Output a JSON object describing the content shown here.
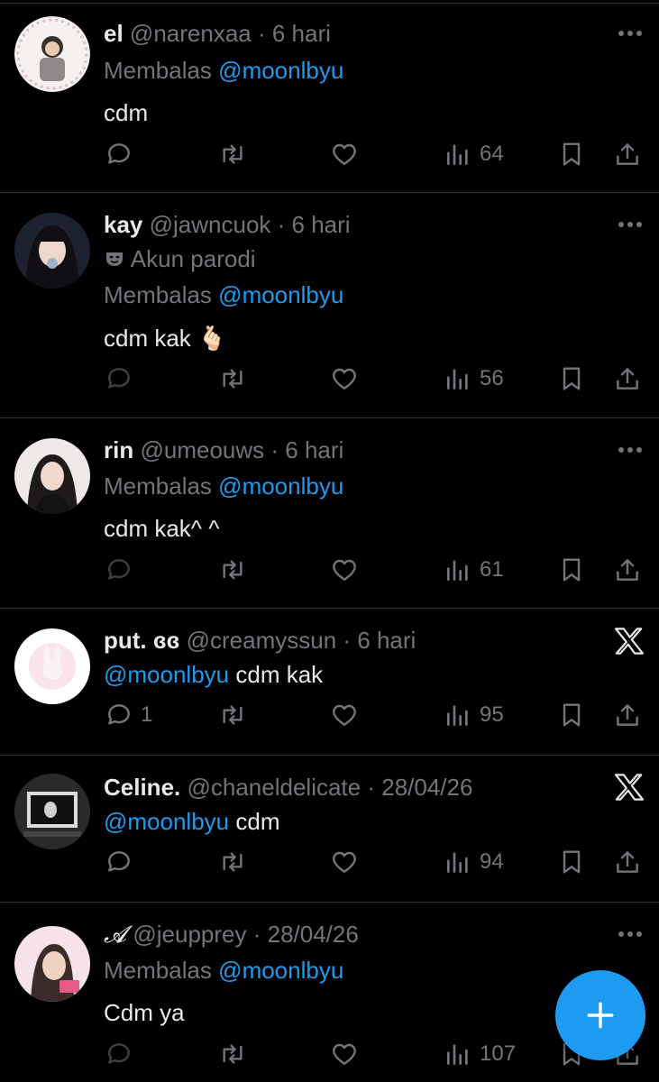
{
  "tweets": [
    {
      "name": "el",
      "handle": "@narenxaa",
      "time": "· 6 hari",
      "parody": "",
      "reply_prefix": "Membalas",
      "reply_to": "@moonlbyu",
      "text": "cdm",
      "mention_inline": "",
      "replies": "",
      "views": "64",
      "top_right": "more-icon"
    },
    {
      "name": "kay",
      "handle": "@jawncuok",
      "time": "· 6 hari",
      "parody": "Akun parodi",
      "reply_prefix": "Membalas",
      "reply_to": "@moonlbyu",
      "text": "cdm kak 🫰🏻",
      "mention_inline": "",
      "replies": "",
      "views": "56",
      "top_right": "more-icon"
    },
    {
      "name": "rin",
      "handle": "@umeouws",
      "time": "· 6 hari",
      "parody": "",
      "reply_prefix": "Membalas",
      "reply_to": "@moonlbyu",
      "text": "cdm kak^ ^",
      "mention_inline": "",
      "replies": "",
      "views": "61",
      "top_right": "more-icon"
    },
    {
      "name": "put. ɞɞ",
      "handle": "@creamyssun",
      "time": "· 6 hari",
      "parody": "",
      "reply_prefix": "",
      "reply_to": "",
      "text": "cdm kak",
      "mention_inline": "@moonlbyu",
      "replies": "1",
      "views": "95",
      "top_right": "x-logo-icon"
    },
    {
      "name": "Celine.",
      "handle": "@chaneldelicate",
      "time": "· 28/04/26",
      "parody": "",
      "reply_prefix": "",
      "reply_to": "",
      "text": "cdm",
      "mention_inline": "@moonlbyu",
      "replies": "",
      "views": "94",
      "top_right": "x-logo-icon"
    },
    {
      "name": "𝓐",
      "handle": "@jeupprey",
      "time": "· 28/04/26",
      "parody": "",
      "reply_prefix": "Membalas",
      "reply_to": "@moonlbyu",
      "text": "Cdm ya",
      "mention_inline": "",
      "replies": "",
      "views": "107",
      "top_right": "more-icon"
    }
  ],
  "colors": {
    "background": "#000000",
    "text": "#e7e9ea",
    "muted": "#71767b",
    "accent": "#1d9bf0",
    "divider": "#2f3336"
  },
  "icons": {
    "reply": "reply-bubble-icon",
    "retweet": "retweet-icon",
    "like": "heart-icon",
    "views": "views-bar-icon",
    "bookmark": "bookmark-icon",
    "share": "share-icon",
    "parody": "theater-mask-icon",
    "compose": "plus-icon"
  }
}
